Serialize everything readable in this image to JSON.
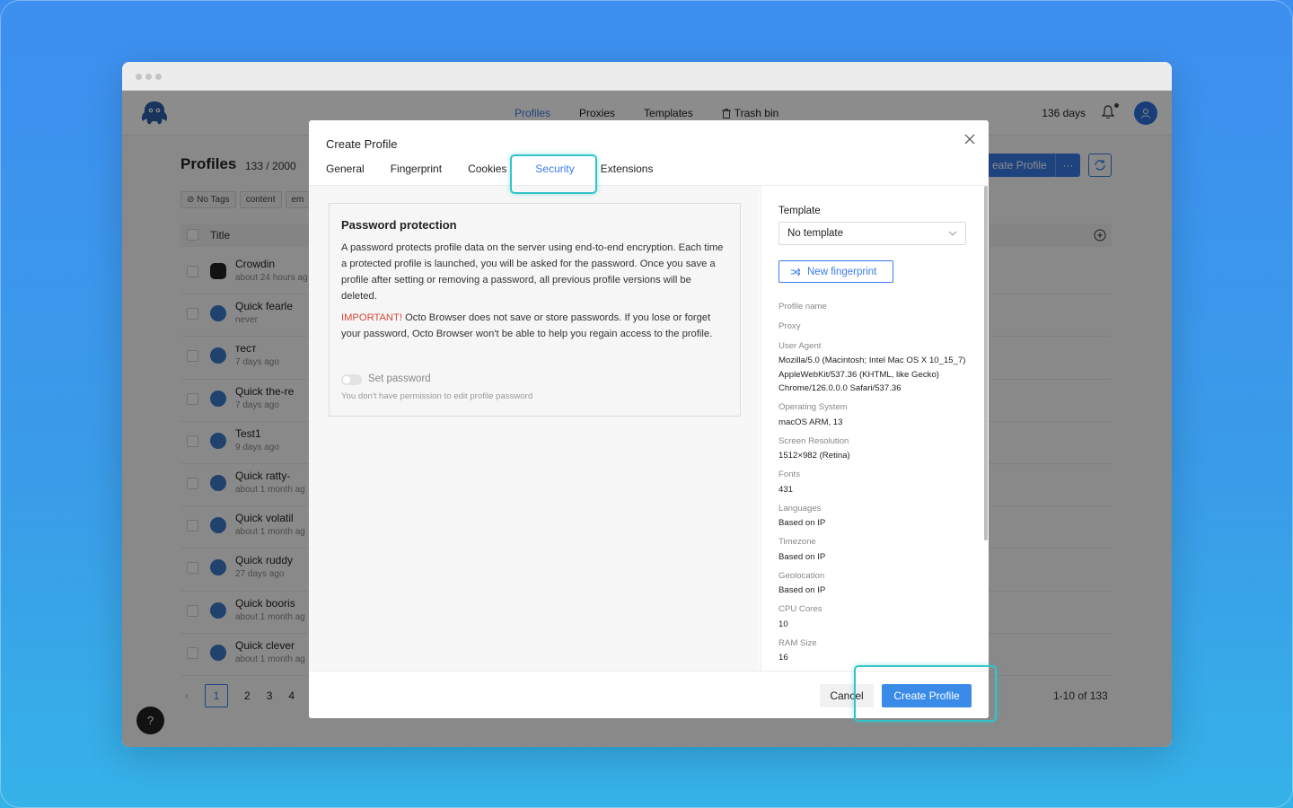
{
  "app": {
    "nav": {
      "profiles": "Profiles",
      "proxies": "Proxies",
      "templates": "Templates",
      "trash": "Trash bin"
    },
    "days_left": "136 days",
    "page_title": "Profiles",
    "profile_count": "133 / 2000",
    "tags": [
      "No Tags",
      "content",
      "em"
    ],
    "create_profile_bg": "eate Profile",
    "create_more_bg": "···",
    "table_title_header": "Title",
    "rows": [
      {
        "name": "Crowdin",
        "time": "about 24 hours ag"
      },
      {
        "name": "Quick fearle",
        "time": "never"
      },
      {
        "name": "тест",
        "time": "7 days ago"
      },
      {
        "name": "Quick the-re",
        "time": "7 days ago"
      },
      {
        "name": "Test1",
        "time": "9 days ago"
      },
      {
        "name": "Quick ratty-",
        "time": "about 1 month ag"
      },
      {
        "name": "Quick volatil",
        "time": "about 1 month ag"
      },
      {
        "name": "Quick ruddy",
        "time": "27 days ago"
      },
      {
        "name": "Quick booris",
        "time": "about 1 month ag"
      },
      {
        "name": "Quick clever",
        "time": "about 1 month ag"
      }
    ],
    "pagination": {
      "prev": "‹",
      "pages": [
        "1",
        "2",
        "3",
        "4"
      ],
      "current": "1"
    },
    "range": "1-10 of 133",
    "help": "?"
  },
  "modal": {
    "title": "Create Profile",
    "tabs": [
      "General",
      "Fingerprint",
      "Cookies",
      "Security",
      "Extensions"
    ],
    "active_tab": "Security",
    "password": {
      "heading": "Password protection",
      "description": "A password protects profile data on the server using end-to-end encryption. Each time a protected profile is launched, you will be asked for the password. Once you save a profile after setting or removing a password, all previous profile versions will be deleted.",
      "important_label": "IMPORTANT!",
      "important_text": " Octo Browser does not save or store passwords. If you lose or forget your password, Octo Browser won't be able to help you regain access to the profile.",
      "toggle_label": "Set password",
      "toggle_on": false,
      "permission_note": "You don't have permission to edit profile password"
    },
    "sidebar": {
      "template_label": "Template",
      "template_value": "No template",
      "new_fingerprint": "New fingerprint",
      "fields": [
        {
          "key": "Profile name",
          "value": ""
        },
        {
          "key": "Proxy",
          "value": ""
        },
        {
          "key": "User Agent",
          "value": "Mozilla/5.0 (Macintosh; Intel Mac OS X 10_15_7) AppleWebKit/537.36 (KHTML, like Gecko) Chrome/126.0.0.0 Safari/537.36"
        },
        {
          "key": "Operating System",
          "value": "macOS ARM, 13"
        },
        {
          "key": "Screen Resolution",
          "value": "1512×982 (Retina)"
        },
        {
          "key": "Fonts",
          "value": "431"
        },
        {
          "key": "Languages",
          "value": "Based on IP"
        },
        {
          "key": "Timezone",
          "value": "Based on IP"
        },
        {
          "key": "Geolocation",
          "value": "Based on IP"
        },
        {
          "key": "CPU Cores",
          "value": "10"
        },
        {
          "key": "RAM Size",
          "value": "16"
        }
      ]
    },
    "footer": {
      "cancel": "Cancel",
      "create": "Create Profile"
    }
  },
  "colors": {
    "accent": "#3a7be8",
    "highlight": "#33c3c8",
    "important": "#d9463a"
  }
}
